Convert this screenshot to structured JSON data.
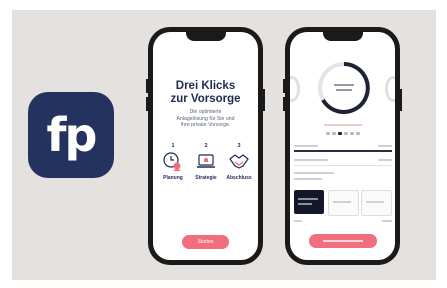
{
  "app_icon": {
    "logo_text": "fp",
    "color": "#23325f"
  },
  "onboarding": {
    "title_line1": "Drei Klicks",
    "title_line2": "zur Vorsorge",
    "subtitle_line1": "Die optimierte",
    "subtitle_line2": "Anlagelösung für Sie und",
    "subtitle_line3": "Ihre private Vorsorge.",
    "steps": [
      {
        "number": "1",
        "label": "Planung",
        "icon": "clock-person-icon"
      },
      {
        "number": "2",
        "label": "Strategie",
        "icon": "laptop-icon"
      },
      {
        "number": "3",
        "label": "Abschluss",
        "icon": "handshake-icon"
      }
    ],
    "cta_label": "Starten",
    "accent_color": "#f06e7d"
  }
}
